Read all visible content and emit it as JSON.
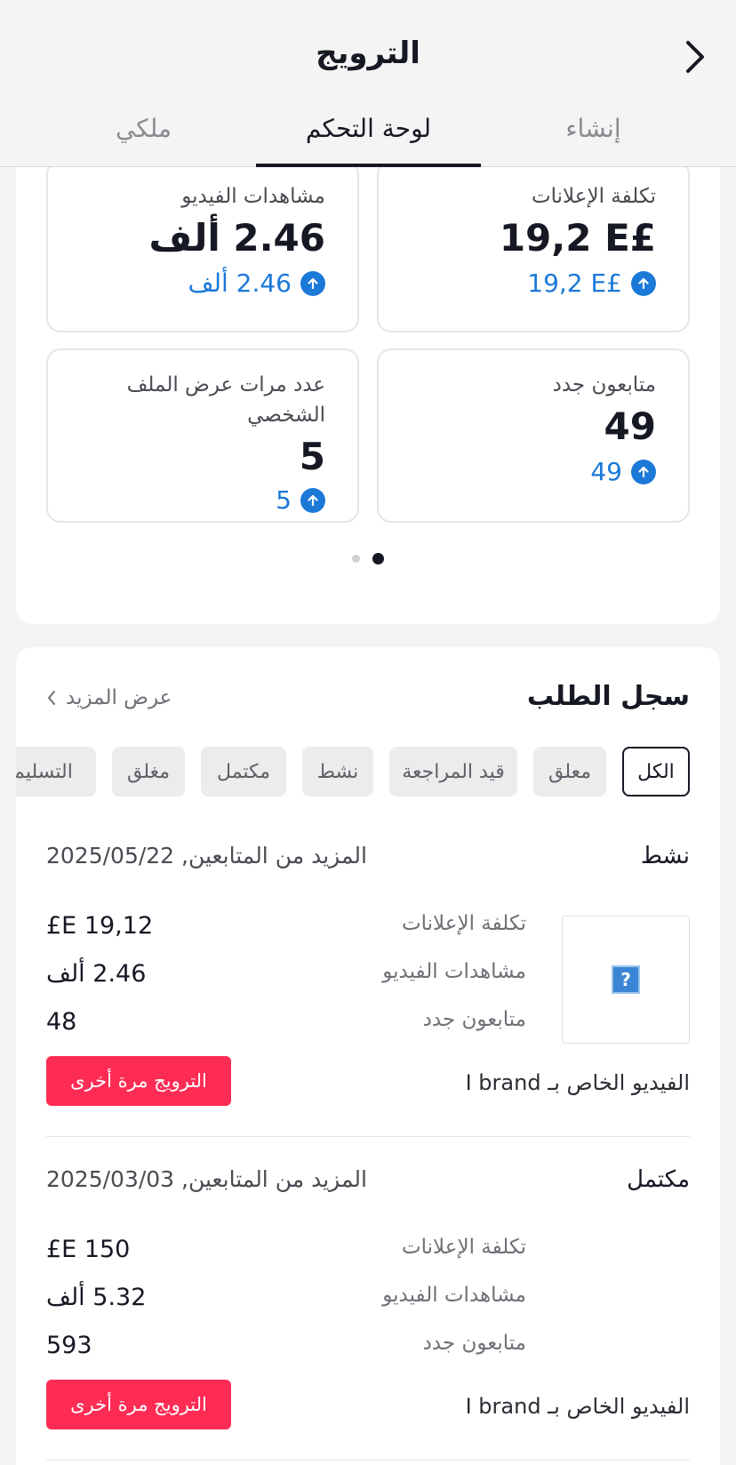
{
  "header": {
    "title": "الترويج",
    "tabs": [
      {
        "label": "إنشاء",
        "active": false
      },
      {
        "label": "لوحة التحكم",
        "active": true
      },
      {
        "label": "ملكي",
        "active": false
      }
    ]
  },
  "metrics": [
    {
      "label": "تكلفة الإعلانات",
      "value": "19,2 E£",
      "delta": "19,2 E£"
    },
    {
      "label": "مشاهدات الفيديو",
      "value": "2.46 ألف",
      "delta": "2.46 ألف"
    },
    {
      "label": "متابعون جدد",
      "value": "49",
      "delta": "49"
    },
    {
      "label": "عدد مرات عرض الملف الشخصي",
      "value": "5",
      "delta": "5"
    }
  ],
  "pager": {
    "count": 2,
    "active_index": 0
  },
  "history": {
    "title": "سجل الطلب",
    "see_more": "عرض المزيد",
    "filters": [
      "الكل",
      "معلق",
      "قيد المراجعة",
      "نشط",
      "مكتمل",
      "مغلق",
      "التسليم"
    ],
    "active_filter": "الكل",
    "orders": [
      {
        "status": "نشط",
        "meta": "المزيد من المتابعين, 2025/05/22",
        "rows": [
          {
            "label": "تكلفة الإعلانات",
            "value": "£E 19,12"
          },
          {
            "label": "مشاهدات الفيديو",
            "value": "2.46 ألف"
          },
          {
            "label": "متابعون جدد",
            "value": "48"
          }
        ],
        "has_thumbnail": true,
        "video_label": "الفيديو الخاص بـ I brand",
        "button": "الترويج مرة أخرى"
      },
      {
        "status": "مكتمل",
        "meta": "المزيد من المتابعين, 2025/03/03",
        "rows": [
          {
            "label": "تكلفة الإعلانات",
            "value": "£E 150"
          },
          {
            "label": "مشاهدات الفيديو",
            "value": "5.32 ألف"
          },
          {
            "label": "متابعون جدد",
            "value": "593"
          }
        ],
        "has_thumbnail": false,
        "video_label": "الفيديو الخاص بـ I brand",
        "button": "الترويج مرة أخرى"
      }
    ]
  },
  "icons": {
    "back": "chevron-right-icon",
    "up": "arrow-up-circle-icon",
    "see_more": "chevron-left-icon",
    "thumbnail": "broken-image-icon"
  },
  "colors": {
    "accent_blue": "#1b79d8",
    "primary_red": "#fe2c55",
    "text": "#161823"
  }
}
